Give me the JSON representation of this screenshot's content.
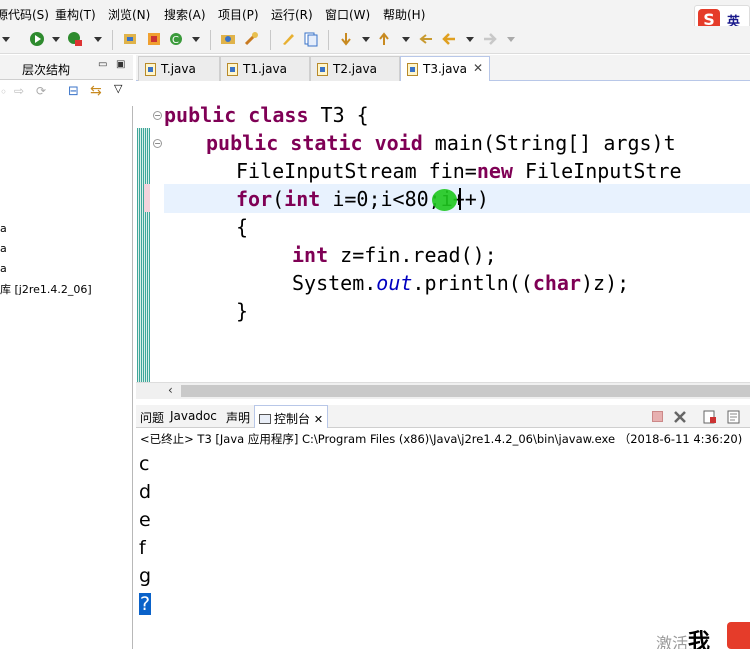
{
  "menu": [
    "源代码(S)",
    "重构(T)",
    "浏览(N)",
    "搜索(A)",
    "项目(P)",
    "运行(R)",
    "窗口(W)",
    "帮助(H)"
  ],
  "ime": {
    "logo": "S",
    "mode": "英"
  },
  "left_panel": {
    "tab_label": "层次结构",
    "items": [
      "a",
      "a",
      "a",
      "库 [j2re1.4.2_06]"
    ]
  },
  "editor_tabs": [
    {
      "name": "T.java",
      "active": false
    },
    {
      "name": "T1.java",
      "active": false
    },
    {
      "name": "T2.java",
      "active": false
    },
    {
      "name": "T3.java",
      "active": true
    }
  ],
  "code": {
    "l1": {
      "kw": "public class",
      "rest": " T3 {"
    },
    "l2": {
      "kw": "public static void",
      "rest": " main(String[] args)t"
    },
    "l3": {
      "pre": "FileInputStream fin=",
      "kw": "new",
      "rest": " FileInputStre"
    },
    "l4": {
      "kw1": "for",
      "p1": "(",
      "kw2": "int",
      "rest": " i=0;i<80;i++)"
    },
    "l5": "{",
    "l6": {
      "kw": "int",
      "rest": " z=fin.read();"
    },
    "l7": {
      "pre": "System.",
      "field": "out",
      "mid": ".println((",
      "kw": "char",
      "rest": ")z);"
    },
    "l8": "}"
  },
  "console": {
    "tabs": [
      "问题",
      "Javadoc",
      "声明",
      "控制台"
    ],
    "active_tab": "控制台",
    "status": "<已终止> T3 [Java 应用程序] C:\\Program Files (x86)\\Java\\j2re1.4.2_06\\bin\\javaw.exe （2018-6-11 4:36:20)",
    "output": [
      "c",
      "d",
      "e",
      "f",
      "g",
      "?"
    ]
  },
  "watermark": {
    "text": "激活",
    "bold": "我"
  },
  "colors": {
    "keyword": "#7f0055",
    "field": "#0000c0",
    "selection": "#0a62c9",
    "current_line": "#e8f2fe"
  }
}
